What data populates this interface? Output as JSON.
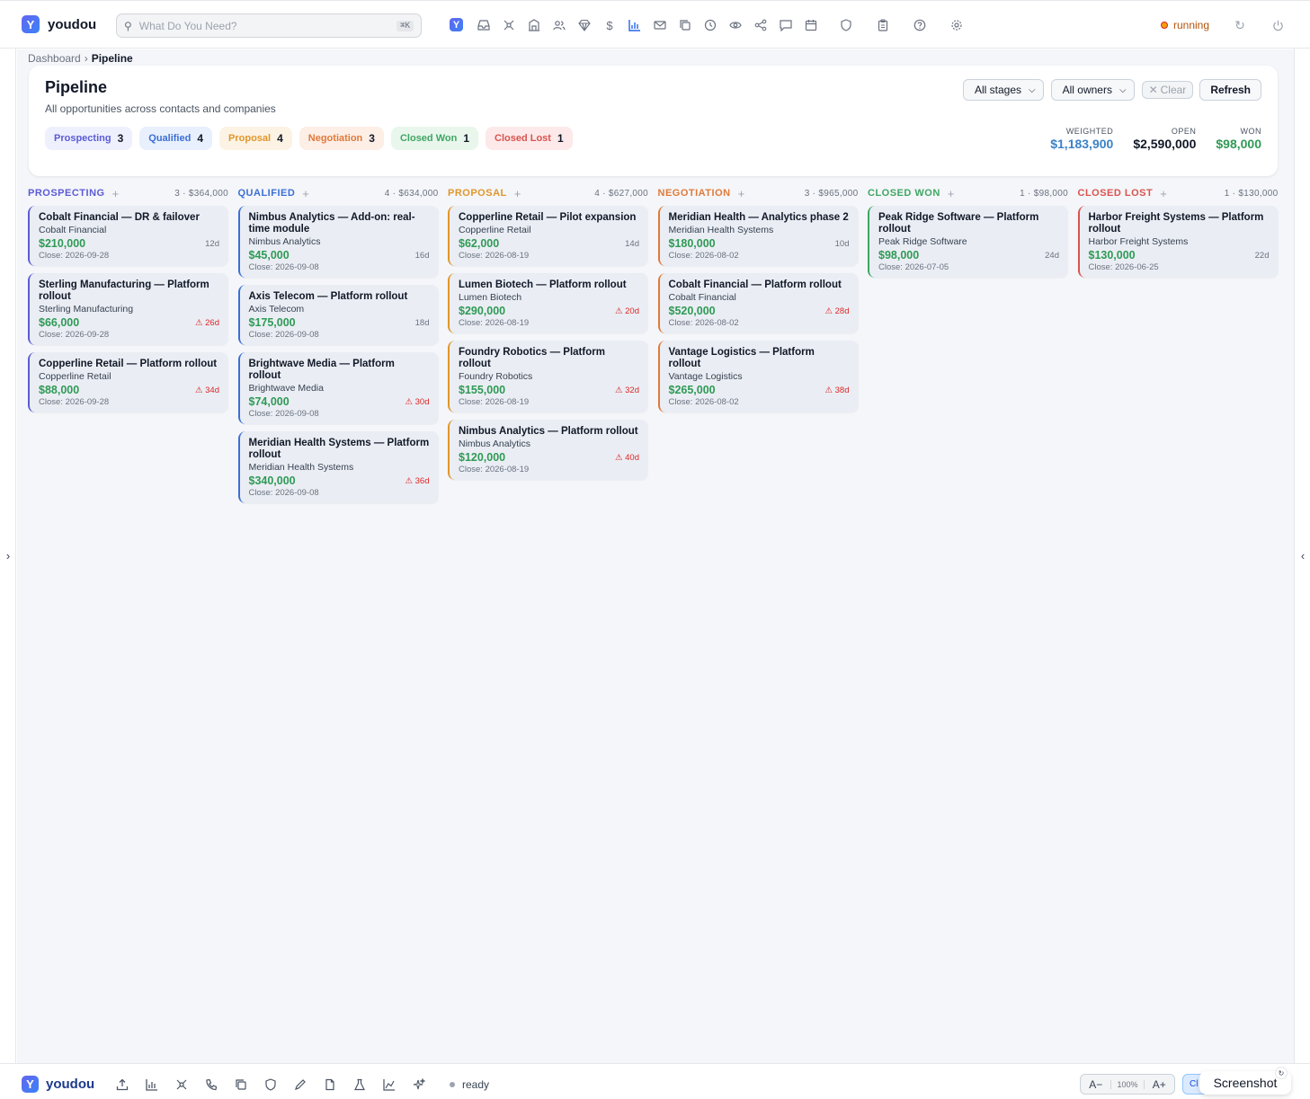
{
  "app": {
    "brand": "youdou",
    "logo_letter": "Y"
  },
  "search": {
    "placeholder": "What Do You Need?",
    "shortcut": "⌘K"
  },
  "status": {
    "label": "running",
    "color": "#f59e0b"
  },
  "breadcrumb": {
    "parent": "Dashboard",
    "separator": "›",
    "current": "Pipeline"
  },
  "header": {
    "title": "Pipeline",
    "subtitle": "All opportunities across contacts and companies",
    "chips": [
      {
        "label": "Prospecting",
        "count": "3"
      },
      {
        "label": "Qualified",
        "count": "4"
      },
      {
        "label": "Proposal",
        "count": "4"
      },
      {
        "label": "Negotiation",
        "count": "3"
      },
      {
        "label": "Closed Won",
        "count": "1"
      },
      {
        "label": "Closed Lost",
        "count": "1"
      }
    ],
    "filters": {
      "stage_value": "All stages",
      "owner_value": "All owners",
      "clear_label": "Clear",
      "refresh_label": "Refresh"
    },
    "kpis": [
      {
        "label": "WEIGHTED",
        "value": "$1,183,900",
        "color": "#3b82c6"
      },
      {
        "label": "OPEN",
        "value": "$2,590,000",
        "color": "#111827"
      },
      {
        "label": "WON",
        "value": "$98,000",
        "color": "#2f9a55"
      }
    ]
  },
  "board": {
    "columns": [
      {
        "title": "PROSPECTING",
        "meta": "3 · $364,000",
        "color": "#5b5bd6",
        "cards": [
          {
            "title": "Cobalt Financial — DR & failover",
            "company": "Cobalt Financial",
            "amount": "$210,000",
            "age": "12d",
            "alert": false,
            "close": "Close: 2026-09-28"
          },
          {
            "title": "Sterling Manufacturing — Platform rollout",
            "company": "Sterling Manufacturing",
            "amount": "$66,000",
            "age": "⚠ 26d",
            "alert": true,
            "close": "Close: 2026-09-28"
          },
          {
            "title": "Copperline Retail — Platform rollout",
            "company": "Copperline Retail",
            "amount": "$88,000",
            "age": "⚠ 34d",
            "alert": true,
            "close": "Close: 2026-09-28"
          }
        ]
      },
      {
        "title": "QUALIFIED",
        "meta": "4 · $634,000",
        "color": "#3b6fd6",
        "cards": [
          {
            "title": "Nimbus Analytics — Add-on: real-time module",
            "company": "Nimbus Analytics",
            "amount": "$45,000",
            "age": "16d",
            "alert": false,
            "close": "Close: 2026-09-08"
          },
          {
            "title": "Axis Telecom — Platform rollout",
            "company": "Axis Telecom",
            "amount": "$175,000",
            "age": "18d",
            "alert": false,
            "close": "Close: 2026-09-08"
          },
          {
            "title": "Brightwave Media — Platform rollout",
            "company": "Brightwave Media",
            "amount": "$74,000",
            "age": "⚠ 30d",
            "alert": true,
            "close": "Close: 2026-09-08"
          },
          {
            "title": "Meridian Health Systems — Platform rollout",
            "company": "Meridian Health Systems",
            "amount": "$340,000",
            "age": "⚠ 36d",
            "alert": true,
            "close": "Close: 2026-09-08"
          }
        ]
      },
      {
        "title": "PROPOSAL",
        "meta": "4 · $627,000",
        "color": "#e0962b",
        "cards": [
          {
            "title": "Copperline Retail — Pilot expansion",
            "company": "Copperline Retail",
            "amount": "$62,000",
            "age": "14d",
            "alert": false,
            "close": "Close: 2026-08-19"
          },
          {
            "title": "Lumen Biotech — Platform rollout",
            "company": "Lumen Biotech",
            "amount": "$290,000",
            "age": "⚠ 20d",
            "alert": true,
            "close": "Close: 2026-08-19"
          },
          {
            "title": "Foundry Robotics — Platform rollout",
            "company": "Foundry Robotics",
            "amount": "$155,000",
            "age": "⚠ 32d",
            "alert": true,
            "close": "Close: 2026-08-19"
          },
          {
            "title": "Nimbus Analytics — Platform rollout",
            "company": "Nimbus Analytics",
            "amount": "$120,000",
            "age": "⚠ 40d",
            "alert": true,
            "close": "Close: 2026-08-19"
          }
        ]
      },
      {
        "title": "NEGOTIATION",
        "meta": "3 · $965,000",
        "color": "#e07a3a",
        "cards": [
          {
            "title": "Meridian Health — Analytics phase 2",
            "company": "Meridian Health Systems",
            "amount": "$180,000",
            "age": "10d",
            "alert": false,
            "close": "Close: 2026-08-02"
          },
          {
            "title": "Cobalt Financial — Platform rollout",
            "company": "Cobalt Financial",
            "amount": "$520,000",
            "age": "⚠ 28d",
            "alert": true,
            "close": "Close: 2026-08-02"
          },
          {
            "title": "Vantage Logistics — Platform rollout",
            "company": "Vantage Logistics",
            "amount": "$265,000",
            "age": "⚠ 38d",
            "alert": true,
            "close": "Close: 2026-08-02"
          }
        ]
      },
      {
        "title": "CLOSED WON",
        "meta": "1 · $98,000",
        "color": "#3fa663",
        "cards": [
          {
            "title": "Peak Ridge Software — Platform rollout",
            "company": "Peak Ridge Software",
            "amount": "$98,000",
            "age": "24d",
            "alert": false,
            "close": "Close: 2026-07-05"
          }
        ]
      },
      {
        "title": "CLOSED LOST",
        "meta": "1 · $130,000",
        "color": "#d9534f",
        "cards": [
          {
            "title": "Harbor Freight Systems — Platform rollout",
            "company": "Harbor Freight Systems",
            "amount": "$130,000",
            "age": "22d",
            "alert": false,
            "close": "Close: 2026-06-25"
          }
        ]
      }
    ]
  },
  "bottombar": {
    "brand": "youdou",
    "status": "ready",
    "zoom": {
      "decrease": "A−",
      "value": "100%",
      "increase": "A+"
    },
    "clip_label": "Cl",
    "screenshot_label": "Screenshot"
  }
}
